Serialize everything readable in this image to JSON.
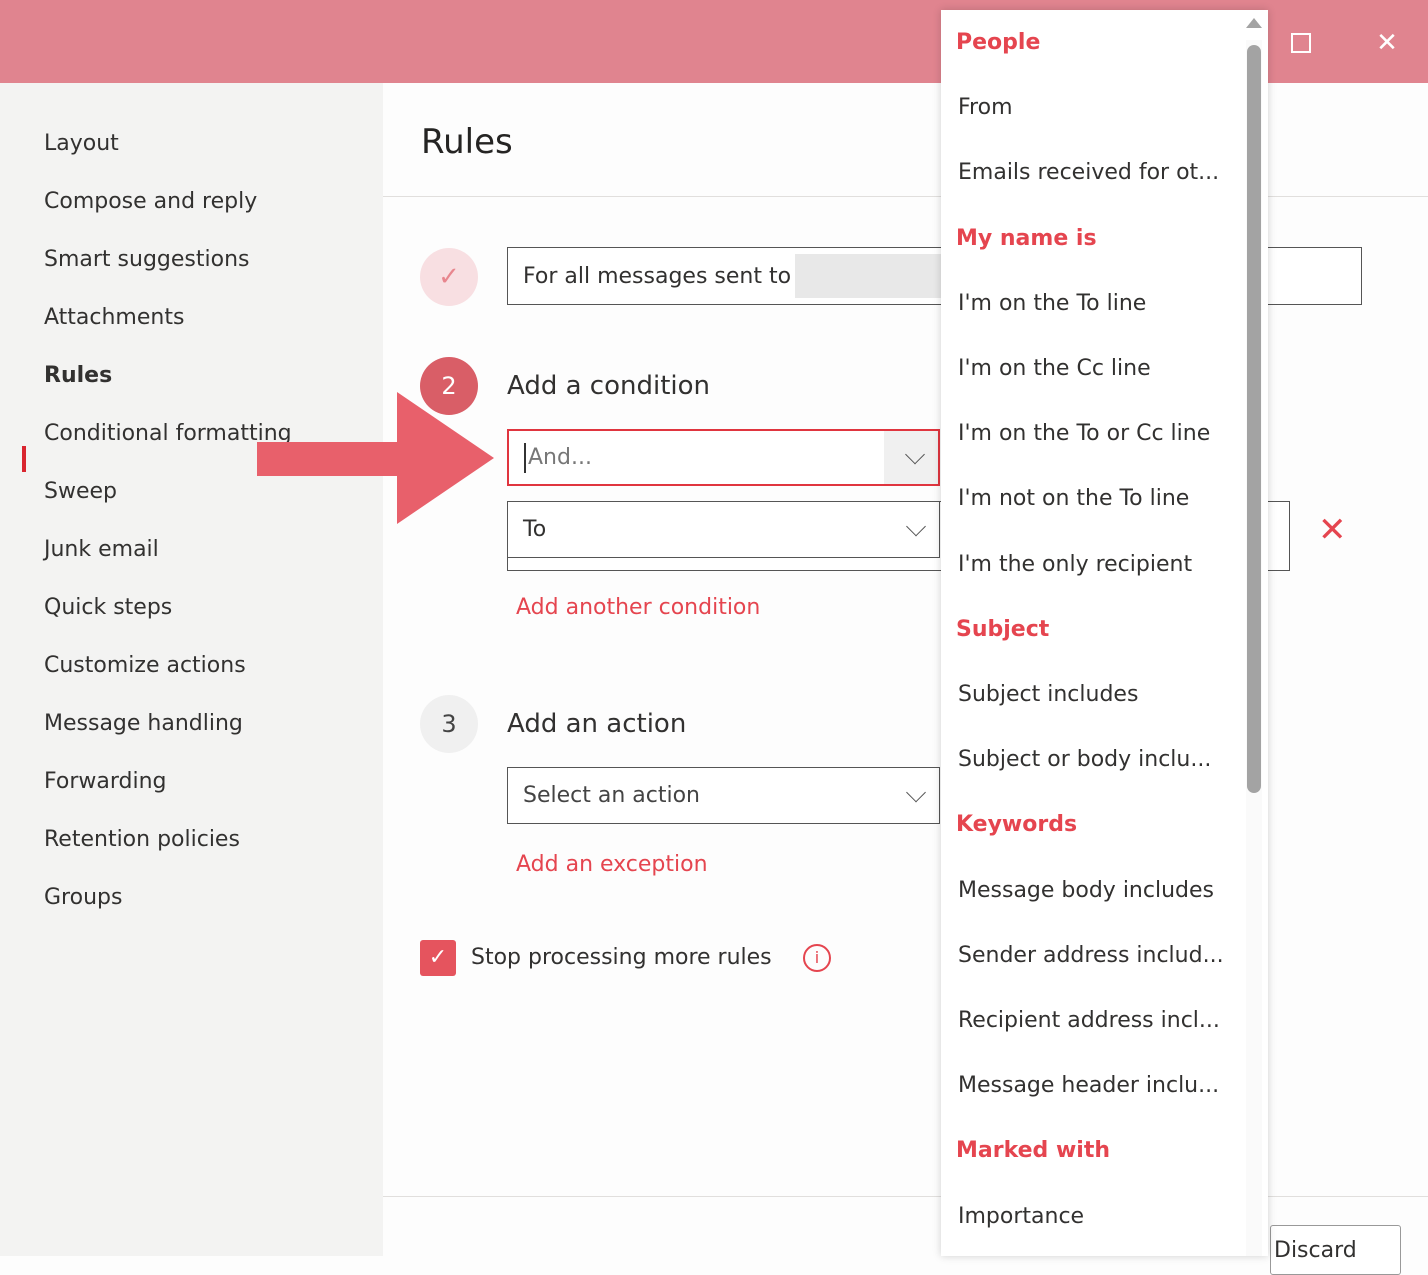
{
  "window": {
    "maximize_icon": "square-icon",
    "close_icon": "x-icon"
  },
  "sidebar": {
    "items": [
      {
        "label": "Layout"
      },
      {
        "label": "Compose and reply"
      },
      {
        "label": "Smart suggestions"
      },
      {
        "label": "Attachments"
      },
      {
        "label": "Rules",
        "active": true
      },
      {
        "label": "Conditional formatting"
      },
      {
        "label": "Sweep"
      },
      {
        "label": "Junk email"
      },
      {
        "label": "Quick steps"
      },
      {
        "label": "Customize actions"
      },
      {
        "label": "Message handling"
      },
      {
        "label": "Forwarding"
      },
      {
        "label": "Retention policies"
      },
      {
        "label": "Groups"
      }
    ]
  },
  "main": {
    "title": "Rules",
    "step1": {
      "value": "For all messages sent to"
    },
    "step2": {
      "number": "2",
      "label": "Add a condition",
      "condition_input": "And...",
      "second_select": "To",
      "add_link": "Add another condition"
    },
    "step3": {
      "number": "3",
      "label": "Add an action",
      "select_placeholder": "Select an action",
      "exception_link": "Add an exception"
    },
    "stop_processing": {
      "label": "Stop processing more rules",
      "checked": true
    },
    "discard_button": "Discard"
  },
  "dropdown": {
    "items": [
      {
        "label": "People",
        "header": true
      },
      {
        "label": "From"
      },
      {
        "label": "Emails received for ot..."
      },
      {
        "label": "My name is",
        "header": true
      },
      {
        "label": "I'm on the To line"
      },
      {
        "label": "I'm on the Cc line"
      },
      {
        "label": "I'm on the To or Cc line"
      },
      {
        "label": "I'm not on the To line"
      },
      {
        "label": "I'm the only recipient"
      },
      {
        "label": "Subject",
        "header": true
      },
      {
        "label": "Subject includes"
      },
      {
        "label": "Subject or body inclu..."
      },
      {
        "label": "Keywords",
        "header": true
      },
      {
        "label": "Message body includes"
      },
      {
        "label": "Sender address includ..."
      },
      {
        "label": "Recipient address incl..."
      },
      {
        "label": "Message header inclu..."
      },
      {
        "label": "Marked with",
        "header": true
      },
      {
        "label": "Importance"
      }
    ]
  },
  "colors": {
    "accent": "#e5454f",
    "titlebar": "#e0848f",
    "arrow": "#e8606b"
  }
}
